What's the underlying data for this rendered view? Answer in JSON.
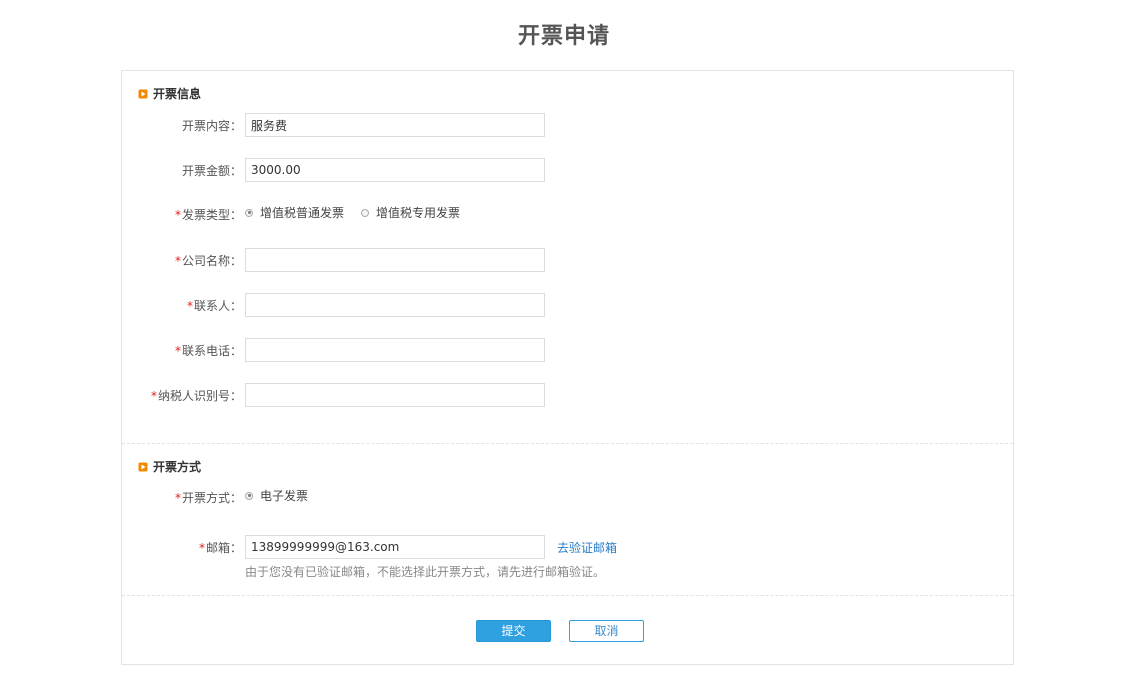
{
  "page": {
    "title": "开票申请"
  },
  "invoice_info": {
    "heading": "开票信息",
    "content": {
      "label": "开票内容：",
      "value": "服务费"
    },
    "amount": {
      "label": "开票金额：",
      "value": "3000.00"
    },
    "type": {
      "label": "发票类型：",
      "options": [
        "增值税普通发票",
        "增值税专用发票"
      ],
      "selected": "增值税普通发票"
    },
    "company": {
      "label": "公司名称：",
      "value": ""
    },
    "contact": {
      "label": "联系人：",
      "value": ""
    },
    "phone": {
      "label": "联系电话：",
      "value": ""
    },
    "tax_id": {
      "label": "纳税人识别号：",
      "value": ""
    }
  },
  "invoice_method": {
    "heading": "开票方式",
    "method": {
      "label": "开票方式：",
      "options": [
        "电子发票"
      ],
      "selected": "电子发票"
    },
    "email": {
      "label": "邮箱：",
      "value": "13899999999@163.com",
      "verify_link": "去验证邮箱",
      "hint": "由于您没有已验证邮箱，不能选择此开票方式，请先进行邮箱验证。"
    }
  },
  "actions": {
    "submit": "提交",
    "cancel": "取消"
  },
  "required_mark": "*",
  "colors": {
    "accent": "#2fa0e0",
    "section_icon": "#f08a00",
    "required": "#e02020",
    "link": "#2b7cc7"
  },
  "icons": {
    "section": "play-triangle-icon"
  }
}
